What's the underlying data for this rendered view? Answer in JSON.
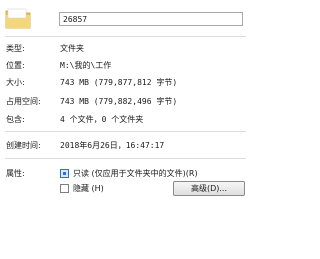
{
  "folder": {
    "icon": "folder-icon",
    "name": "26857"
  },
  "rows": {
    "type_label": "类型:",
    "type_value": "文件夹",
    "location_label": "位置:",
    "location_value": "M:\\我的\\工作",
    "size_label": "大小:",
    "size_value": "743 MB (779,877,812 字节)",
    "disk_size_label": "占用空间:",
    "disk_size_value": "743 MB (779,882,496 字节)",
    "contains_label": "包含:",
    "contains_value": "4 个文件，0 个文件夹",
    "created_label": "创建时间:",
    "created_value": "2018年6月26日，16:47:17"
  },
  "attributes": {
    "label": "属性:",
    "readonly_label": "只读 (仅应用于文件夹中的文件)(R)",
    "readonly_state": "indeterminate",
    "hidden_label": "隐藏 (H)",
    "hidden_checked": false,
    "advanced_button": "高级(D)..."
  }
}
